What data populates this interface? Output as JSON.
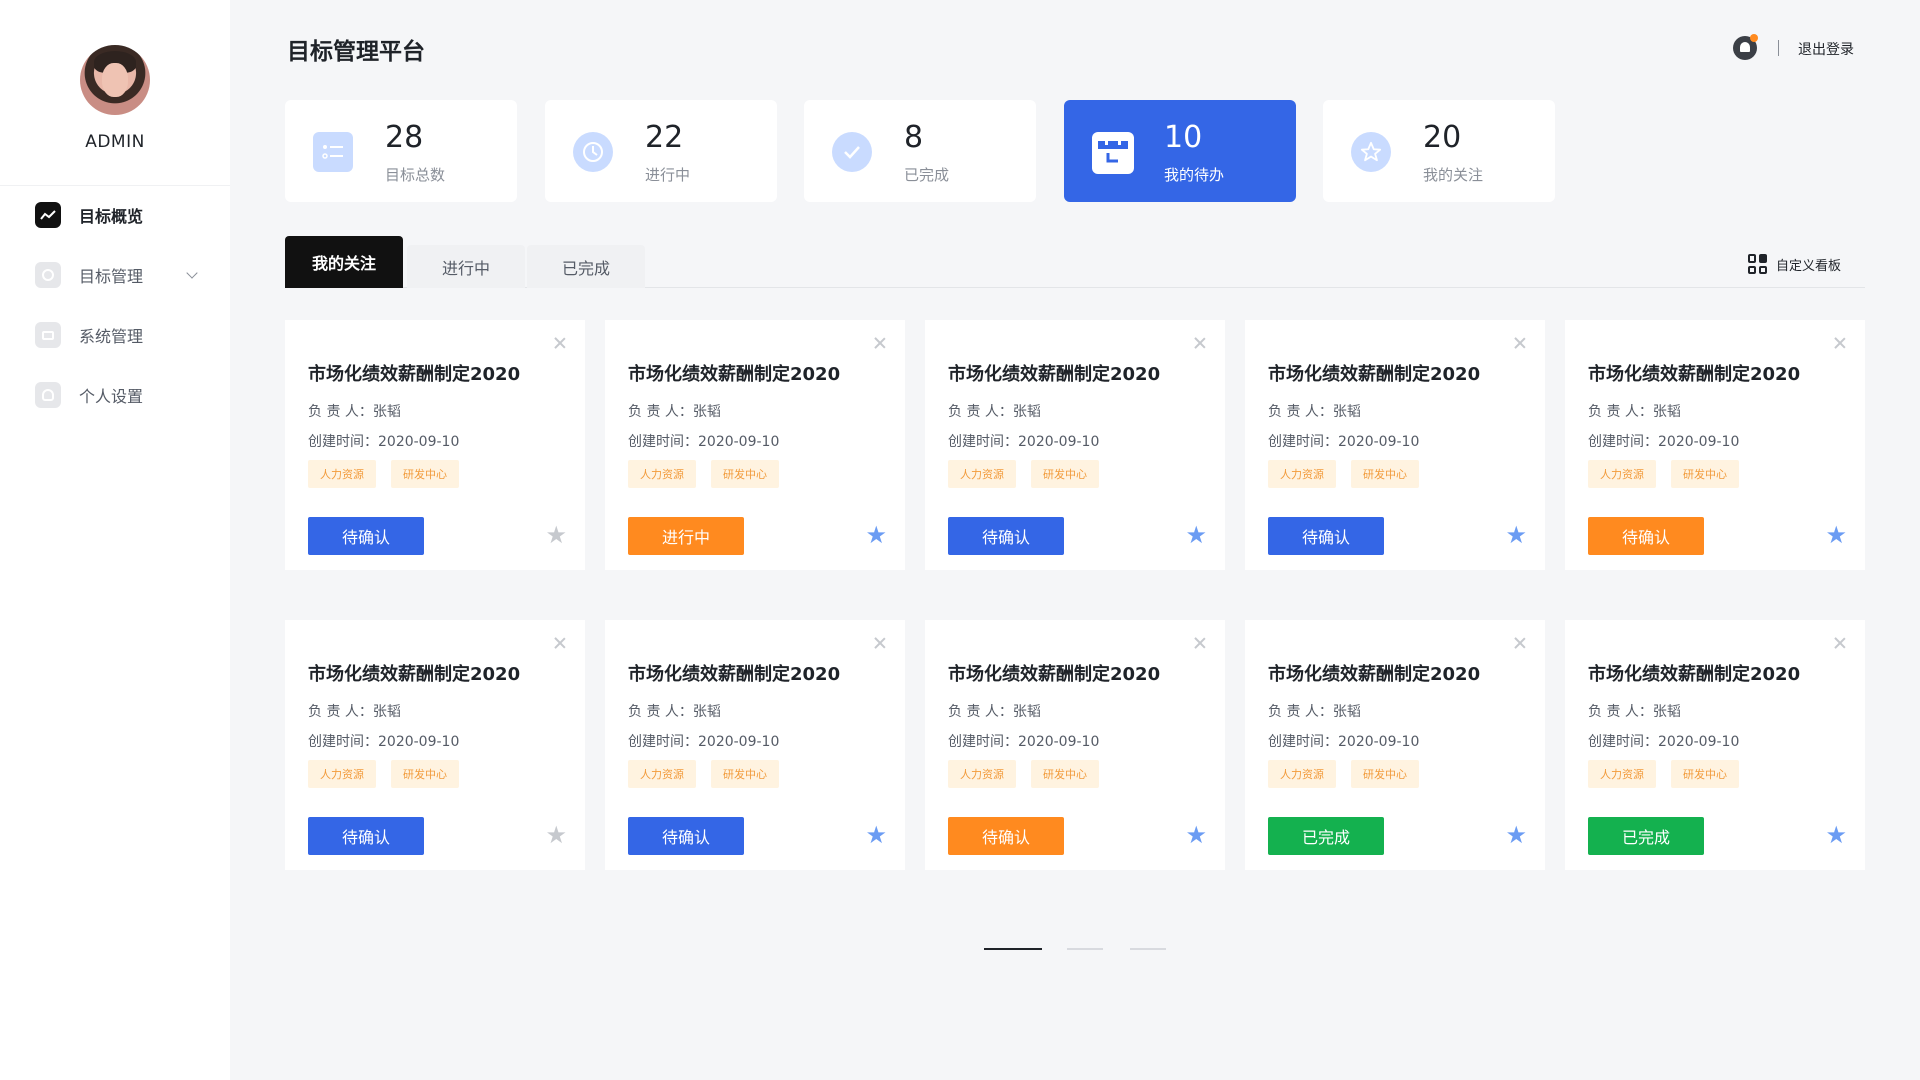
{
  "app": {
    "title": "目标管理平台",
    "logout": "退出登录"
  },
  "user": {
    "name": "ADMIN"
  },
  "sidebar": {
    "items": [
      {
        "label": "目标概览",
        "icon": "chart-icon",
        "active": true
      },
      {
        "label": "目标管理",
        "icon": "target-icon",
        "active": false,
        "expandable": true
      },
      {
        "label": "系统管理",
        "icon": "monitor-icon",
        "active": false
      },
      {
        "label": "个人设置",
        "icon": "person-icon",
        "active": false
      }
    ]
  },
  "stats": [
    {
      "value": "28",
      "label": "目标总数",
      "icon": "checklist-icon"
    },
    {
      "value": "22",
      "label": "进行中",
      "icon": "clock-icon"
    },
    {
      "value": "8",
      "label": "已完成",
      "icon": "check-icon"
    },
    {
      "value": "10",
      "label": "我的待办",
      "icon": "calendar-icon",
      "active": true
    },
    {
      "value": "20",
      "label": "我的关注",
      "icon": "star-icon"
    }
  ],
  "tabs": [
    {
      "label": "我的关注",
      "active": true
    },
    {
      "label": "进行中",
      "active": false
    },
    {
      "label": "已完成",
      "active": false
    }
  ],
  "customize_label": "自定义看板",
  "cards": [
    {
      "title": "市场化绩效薪酬制定2020",
      "owner": "负  责  人：张韬",
      "created": "创建时间：2020-09-10",
      "tags": [
        "人力资源",
        "研发中心"
      ],
      "status": "待确认",
      "status_color": "blue",
      "starred": false
    },
    {
      "title": "市场化绩效薪酬制定2020",
      "owner": "负  责  人：张韬",
      "created": "创建时间：2020-09-10",
      "tags": [
        "人力资源",
        "研发中心"
      ],
      "status": "进行中",
      "status_color": "orange",
      "starred": true
    },
    {
      "title": "市场化绩效薪酬制定2020",
      "owner": "负  责  人：张韬",
      "created": "创建时间：2020-09-10",
      "tags": [
        "人力资源",
        "研发中心"
      ],
      "status": "待确认",
      "status_color": "blue",
      "starred": true
    },
    {
      "title": "市场化绩效薪酬制定2020",
      "owner": "负  责  人：张韬",
      "created": "创建时间：2020-09-10",
      "tags": [
        "人力资源",
        "研发中心"
      ],
      "status": "待确认",
      "status_color": "blue",
      "starred": true
    },
    {
      "title": "市场化绩效薪酬制定2020",
      "owner": "负  责  人：张韬",
      "created": "创建时间：2020-09-10",
      "tags": [
        "人力资源",
        "研发中心"
      ],
      "status": "待确认",
      "status_color": "orange",
      "starred": true
    },
    {
      "title": "市场化绩效薪酬制定2020",
      "owner": "负  责  人：张韬",
      "created": "创建时间：2020-09-10",
      "tags": [
        "人力资源",
        "研发中心"
      ],
      "status": "待确认",
      "status_color": "blue",
      "starred": false
    },
    {
      "title": "市场化绩效薪酬制定2020",
      "owner": "负  责  人：张韬",
      "created": "创建时间：2020-09-10",
      "tags": [
        "人力资源",
        "研发中心"
      ],
      "status": "待确认",
      "status_color": "blue",
      "starred": true
    },
    {
      "title": "市场化绩效薪酬制定2020",
      "owner": "负  责  人：张韬",
      "created": "创建时间：2020-09-10",
      "tags": [
        "人力资源",
        "研发中心"
      ],
      "status": "待确认",
      "status_color": "orange",
      "starred": true
    },
    {
      "title": "市场化绩效薪酬制定2020",
      "owner": "负  责  人：张韬",
      "created": "创建时间：2020-09-10",
      "tags": [
        "人力资源",
        "研发中心"
      ],
      "status": "已完成",
      "status_color": "green",
      "starred": true
    },
    {
      "title": "市场化绩效薪酬制定2020",
      "owner": "负  责  人：张韬",
      "created": "创建时间：2020-09-10",
      "tags": [
        "人力资源",
        "研发中心"
      ],
      "status": "已完成",
      "status_color": "green",
      "starred": true
    }
  ],
  "pagination": {
    "pages": 3,
    "current": 1
  },
  "colors": {
    "primary": "#3466e6",
    "orange": "#ff8a1f",
    "green": "#14b14f",
    "tag_bg": "#fff3e0",
    "tag_text": "#f29b3b"
  }
}
